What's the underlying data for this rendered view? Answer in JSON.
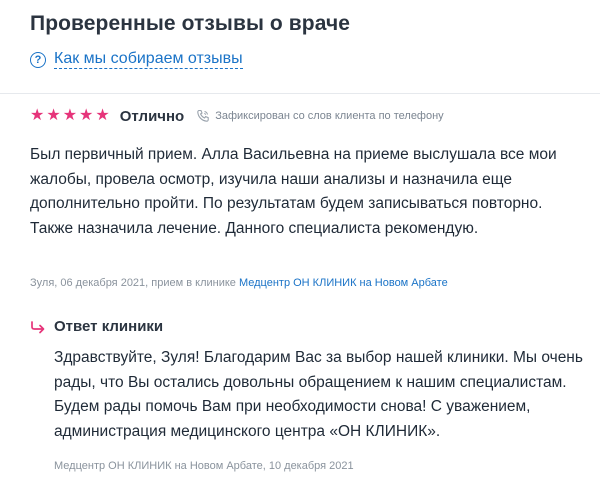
{
  "header": {
    "title": "Проверенные отзывы о враче",
    "how_link": "Как мы собираем отзывы",
    "how_icon": "question-circle-icon"
  },
  "review": {
    "stars": 5,
    "star_color": "#e6347a",
    "grade": "Отлично",
    "recorded_note": "Зафиксирован со слов клиента по телефону",
    "recorded_icon": "phone-icon",
    "text": "Был первичный прием. Алла Васильевна на приеме выслушала все мои жалобы, провела осмотр, изучила наши анализы и назначила еще дополнительно пройти. По результатам будем записываться повторно. Также назначила лечение. Данного специалиста рекомендую.",
    "meta_prefix": "Зуля, 06 декабря 2021, прием в клинике",
    "clinic_link": "Медцентр ОН КЛИНИК на Новом Арбате"
  },
  "answer": {
    "icon": "reply-arrow-icon",
    "title": "Ответ клиники",
    "text": "Здравствуйте, Зуля! Благодарим Вас за выбор нашей клиники. Мы очень рады, что Вы остались довольны обращением к нашим специалистам. Будем рады помочь Вам при необходимости снова! С уважением, администрация медицинского центра «ОН КЛИНИК».",
    "meta": "Медцентр ОН КЛИНИК на Новом Арбате, 10 декабря 2021"
  },
  "colors": {
    "link": "#1a73c7",
    "accent": "#e6347a",
    "text": "#1f2a37",
    "muted": "#8a939d"
  }
}
